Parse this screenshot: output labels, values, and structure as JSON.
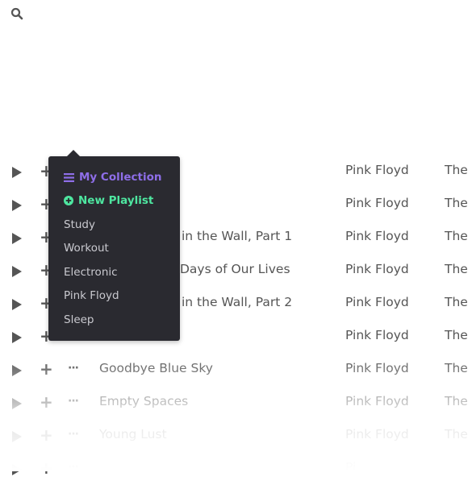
{
  "toolbar": {
    "search_icon": "search-icon"
  },
  "tracks": [
    {
      "title": "",
      "artist": "Pink Floyd",
      "album": "The W"
    },
    {
      "title": "",
      "artist": "Pink Floyd",
      "album": "The W"
    },
    {
      "title": "in the Wall, Part 1",
      "artist": "Pink Floyd",
      "album": "The W"
    },
    {
      "title": "Days of Our Lives",
      "artist": "Pink Floyd",
      "album": "The W"
    },
    {
      "title": "in the Wall, Part 2",
      "artist": "Pink Floyd",
      "album": "The W"
    },
    {
      "title": "",
      "artist": "Pink Floyd",
      "album": "The W"
    },
    {
      "title": "Goodbye Blue Sky",
      "artist": "Pink Floyd",
      "album": "The W"
    },
    {
      "title": "Empty Spaces",
      "artist": "Pink Floyd",
      "album": "The W"
    },
    {
      "title": "Young Lust",
      "artist": "Pink Floyd",
      "album": "The W"
    },
    {
      "title": "",
      "artist": "Pi",
      "album": ""
    }
  ],
  "playlist_menu": {
    "collection_label": "My Collection",
    "new_playlist_label": "New Playlist",
    "playlists": [
      "Study",
      "Workout",
      "Electronic",
      "Pink Floyd",
      "Sleep"
    ]
  },
  "colors": {
    "menu_bg": "#2a2a30",
    "collection_accent": "#8e6ee8",
    "new_playlist_accent": "#4ee6a0",
    "text": "#555555"
  }
}
